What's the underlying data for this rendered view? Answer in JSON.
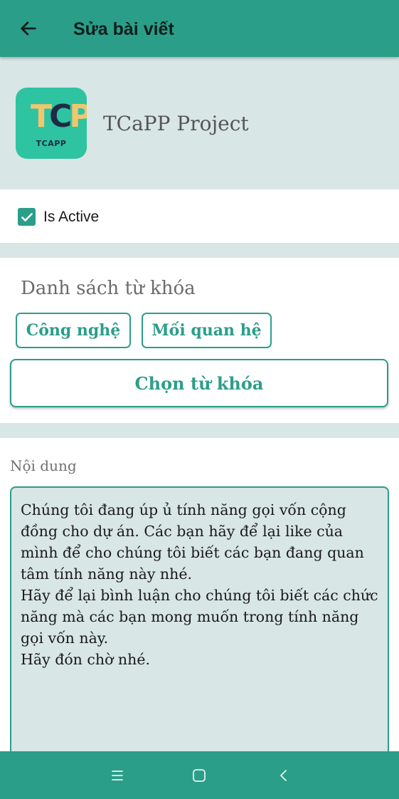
{
  "topbar": {
    "title": "Sửa bài viết",
    "back_icon": "arrow-left-icon"
  },
  "project": {
    "logo_letters": [
      "T",
      "C",
      "P"
    ],
    "logo_caption": "TCAPP",
    "name": "TCaPP Project"
  },
  "active": {
    "checked": true,
    "label": "Is Active"
  },
  "keywords": {
    "title": "Danh sách từ khóa",
    "chips": [
      "Công nghệ",
      "Mối quan hệ"
    ],
    "choose_label": "Chọn từ khóa"
  },
  "content": {
    "label": "Nội dung",
    "text": "Chúng tôi đang úp ủ tính năng gọi vốn cộng đồng cho dự án. Các bạn hãy để lại like của mình để cho chúng tôi biết các bạn đang quan tâm tính năng này nhé.\nHãy để lại bình luận cho chúng tôi biết các chức năng mà các bạn mong muốn trong tính năng gọi vốn này.\nHãy đón chờ nhé."
  },
  "navbar": {
    "icons": [
      "menu-icon",
      "home-square-icon",
      "back-chevron-icon"
    ]
  },
  "colors": {
    "primary": "#2b9e8a",
    "background": "#d8e6e5",
    "logo_bg": "#2ec3a1",
    "logo_accent": "#f2c66d"
  }
}
